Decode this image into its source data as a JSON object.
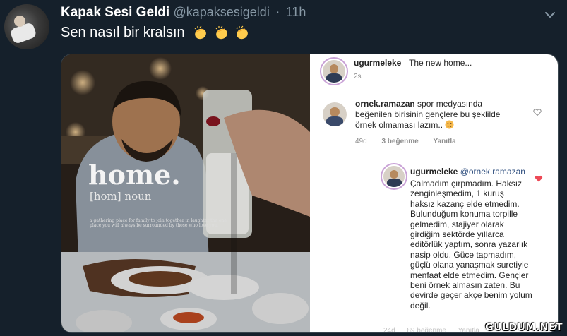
{
  "tweet": {
    "display_name": "Kapak Sesi Geldi",
    "handle": "@kapaksesigeldi",
    "separator": "·",
    "time": "11h",
    "text": "Sen nasıl bir kralsın",
    "emoji_icons": [
      "clapping-hands-icon",
      "clapping-hands-icon",
      "clapping-hands-icon"
    ]
  },
  "photo_overlay": {
    "title": "home.",
    "phonetic_a": "[hom]",
    "phonetic_b": "noun",
    "definition": "a gathering place for family to join together in laughter the one place you will always be surrounded by those who love you."
  },
  "instagram": {
    "post": {
      "username": "ugurmeleke",
      "caption": "The new home...",
      "age": "2s"
    },
    "comment": {
      "username": "ornek.ramazan",
      "text_line1": "spor medyasında",
      "text_line2": "beğenilen birisinin gençlere bu şeklilde",
      "text_line3": "örnek olmaması lazım..",
      "emoji": "sad-face-icon",
      "age": "49d",
      "likes": "3 beğenme",
      "reply": "Yanıtla"
    },
    "reply": {
      "username": "ugurmeleke",
      "mention": "@ornek.ramazan",
      "lines": [
        "Çalmadım çırpmadım. Haksız",
        "zenginleşmedim, 1 kuruş",
        "haksız kazanç elde etmedim.",
        "Bulunduğum konuma torpille",
        "gelmedim, stajiyer olarak",
        "girdiğim sektörde yıllarca",
        "editörlük yaptım, sonra yazarlık",
        "nasip oldu. Güce tapmadım,",
        "güçlü olana yanaşmak suretiyle",
        "menfaat elde etmedim. Gençler",
        "beni örnek almasın zaten. Bu",
        "devirde geçer akçe benim yolum",
        "değil."
      ],
      "meta_partial": "24d      89 beğenme      Yanıtla"
    }
  },
  "watermark": "GULDUM.NET",
  "colors": {
    "background": "#15202b",
    "secondary_text": "#8899a6",
    "heart_liked": "#ed4956"
  }
}
